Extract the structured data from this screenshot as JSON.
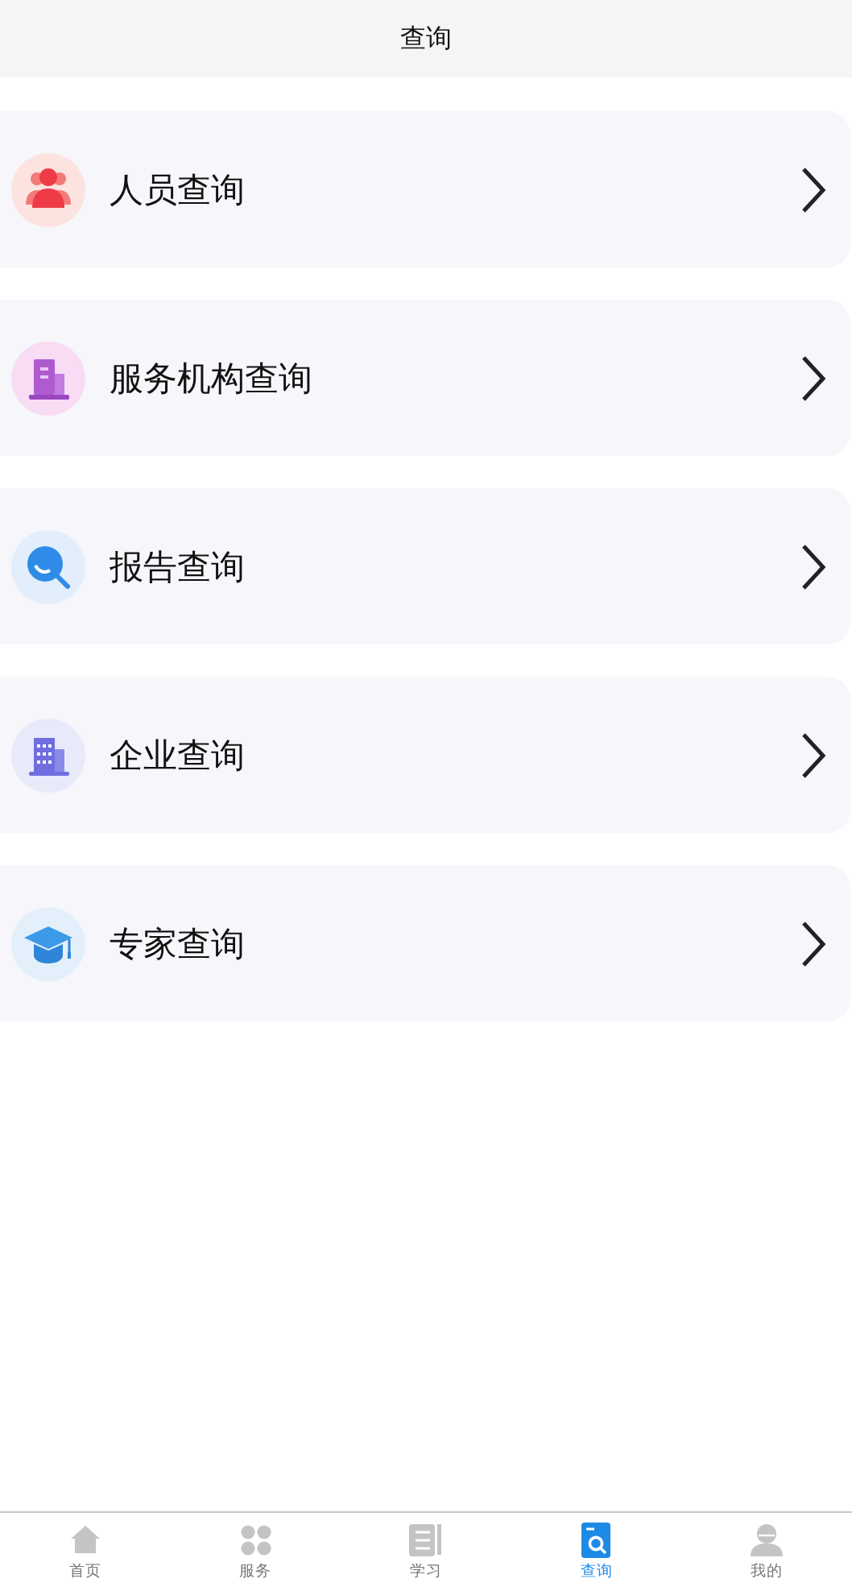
{
  "header": {
    "title": "查询"
  },
  "items": [
    {
      "label": "人员查询"
    },
    {
      "label": "服务机构查询"
    },
    {
      "label": "报告查询"
    },
    {
      "label": "企业查询"
    },
    {
      "label": "专家查询"
    }
  ],
  "tab_bar": [
    {
      "label": "首页",
      "selected": false
    },
    {
      "label": "服务",
      "selected": false
    },
    {
      "label": "学习",
      "selected": false
    },
    {
      "label": "查询",
      "selected": true
    },
    {
      "label": "我的",
      "selected": false
    }
  ]
}
